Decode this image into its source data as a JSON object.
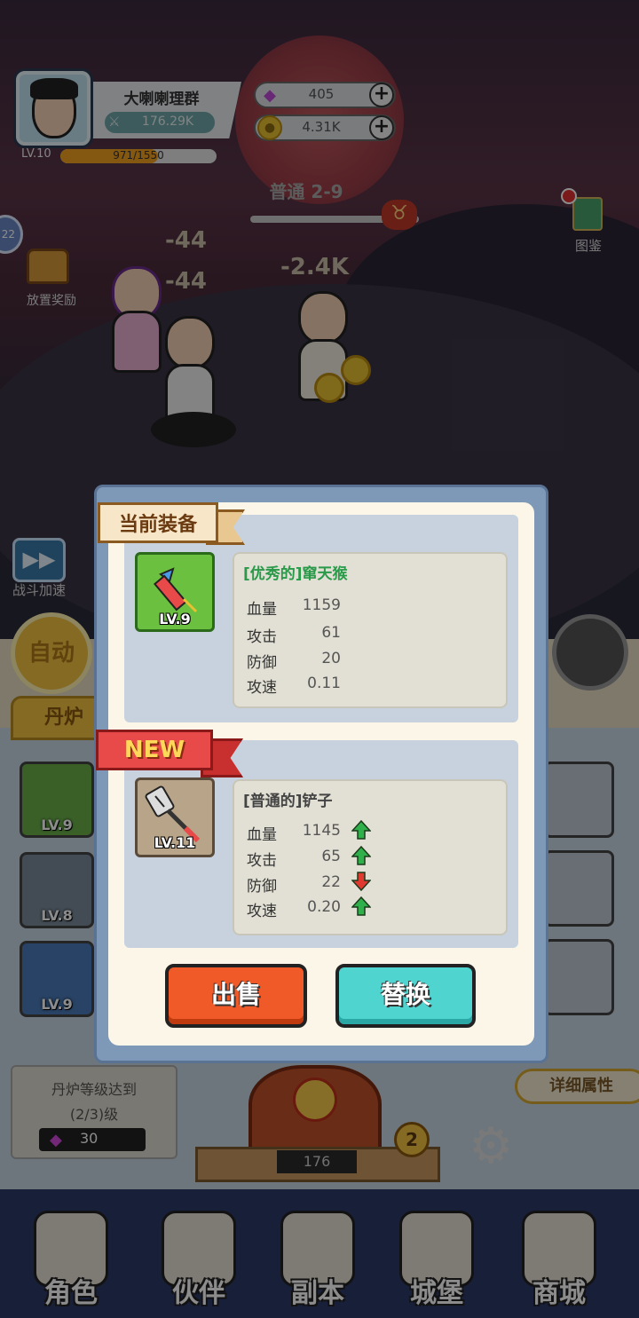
{
  "player": {
    "name": "大喇喇理群",
    "power": "176.29K",
    "level": "LV.10",
    "xp_text": "971/1550",
    "xp_fraction": 0.626
  },
  "resources": {
    "gems": "405",
    "gold": "4.31K"
  },
  "stage": {
    "label": "普通 2-9",
    "progress_fraction": 0.6
  },
  "side": {
    "codex_label": "图鉴",
    "side_badge": "22",
    "idle_reward_label": "放置奖励",
    "battle_speed_label": "战斗加速"
  },
  "damage_numbers": [
    "-44",
    "-44",
    "-2.4K"
  ],
  "controls": {
    "auto_label": "自动",
    "furnace_tab": "丹炉",
    "detail_button": "详细属性"
  },
  "inventory": [
    {
      "level": "LV.9",
      "icon": "rocket-icon",
      "color": "#6ab04a"
    },
    {
      "level": "LV.8",
      "icon": "ruler-icon",
      "color": "#7a8a9a"
    },
    {
      "level": "LV.9",
      "icon": "bucket-icon",
      "color": "#4a7ab8"
    }
  ],
  "furnace": {
    "requirement_line1": "丹炉等级达到",
    "requirement_line2": "(2/3)级",
    "cost": "30",
    "counter": "176",
    "badge": "2"
  },
  "modal": {
    "current_banner": "当前装备",
    "new_banner": "NEW",
    "current_item": {
      "name": "[优秀的]窜天猴",
      "level": "LV.9",
      "icon": "firework-rocket-icon",
      "name_color": "#2a9a4a",
      "stats": [
        {
          "label": "血量",
          "value": "1159"
        },
        {
          "label": "攻击",
          "value": "61"
        },
        {
          "label": "防御",
          "value": "20"
        },
        {
          "label": "攻速",
          "value": "0.11"
        }
      ]
    },
    "new_item": {
      "name": "[普通的]铲子",
      "level": "LV.11",
      "icon": "spatula-icon",
      "name_color": "#444444",
      "stats": [
        {
          "label": "血量",
          "value": "1145",
          "trend": "up"
        },
        {
          "label": "攻击",
          "value": "65",
          "trend": "up"
        },
        {
          "label": "防御",
          "value": "22",
          "trend": "down"
        },
        {
          "label": "攻速",
          "value": "0.20",
          "trend": "up"
        }
      ]
    },
    "sell_label": "出售",
    "replace_label": "替换"
  },
  "nav": [
    {
      "label": "角色",
      "icon": "character-icon"
    },
    {
      "label": "伙伴",
      "icon": "partner-icon"
    },
    {
      "label": "副本",
      "icon": "dungeon-scroll-icon"
    },
    {
      "label": "城堡",
      "icon": "castle-icon"
    },
    {
      "label": "商城",
      "icon": "shop-icon"
    }
  ],
  "colors": {
    "trend_up": "#2fb04a",
    "trend_down": "#e03a30",
    "sell_button": "#f05a28",
    "replace_button": "#4fd4d0"
  }
}
